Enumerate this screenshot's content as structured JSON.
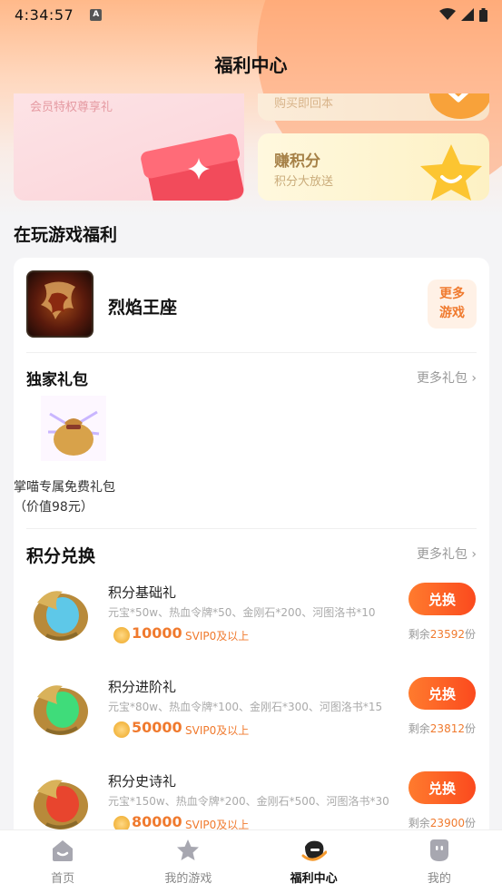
{
  "status_bar": {
    "time": "4:34:57",
    "badge": "A"
  },
  "header": {
    "title": "福利中心"
  },
  "banners": {
    "left_sub": "会员特权尊享礼",
    "right_top_sub": "购买即回本",
    "right_bottom_title": "赚积分",
    "right_bottom_sub": "积分大放送"
  },
  "section": {
    "title": "在玩游戏福利"
  },
  "game": {
    "name": "烈焰王座",
    "more_label_1": "更多",
    "more_label_2": "游戏"
  },
  "exclusive": {
    "title": "独家礼包",
    "more": "更多礼包 ›",
    "gift": {
      "name": "掌喵专属免费礼包",
      "price": "（价值98元）"
    }
  },
  "exchange": {
    "title": "积分兑换",
    "more": "更多礼包 ›",
    "items": [
      {
        "name": "积分基础礼",
        "desc": "元宝*50w、热血令牌*50、金刚石*200、河图洛书*10",
        "points": "10000",
        "vip": "SVIP0及以上",
        "button": "兑换",
        "remain_prefix": "剩余",
        "remain_num": "23592",
        "remain_suffix": "份",
        "color": "#5ec8e8"
      },
      {
        "name": "积分进阶礼",
        "desc": "元宝*80w、热血令牌*100、金刚石*300、河图洛书*15",
        "points": "50000",
        "vip": "SVIP0及以上",
        "button": "兑换",
        "remain_prefix": "剩余",
        "remain_num": "23812",
        "remain_suffix": "份",
        "color": "#3fdc7a"
      },
      {
        "name": "积分史诗礼",
        "desc": "元宝*150w、热血令牌*200、金刚石*500、河图洛书*30",
        "points": "80000",
        "vip": "SVIP0及以上",
        "button": "兑换",
        "remain_prefix": "剩余",
        "remain_num": "23900",
        "remain_suffix": "份",
        "color": "#e8452e"
      }
    ]
  },
  "tabbar": {
    "tabs": [
      {
        "label": "首页",
        "icon": "home-icon"
      },
      {
        "label": "我的游戏",
        "icon": "star-icon"
      },
      {
        "label": "福利中心",
        "icon": "welfare-icon"
      },
      {
        "label": "我的",
        "icon": "profile-icon"
      }
    ],
    "active_index": 2
  },
  "colors": {
    "accent": "#f07a2e",
    "button": "#fb4a1e"
  }
}
